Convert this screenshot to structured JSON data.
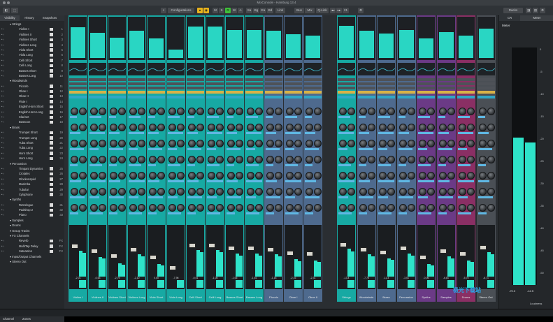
{
  "window": {
    "title": "MixConsole - Hamburg 13.4"
  },
  "toolbar": {
    "configurations_label": "Configurations",
    "buttons": [
      "M",
      "S",
      "R",
      "W",
      "A",
      "Sa",
      "Bg",
      "Ea",
      "Bd",
      "Link",
      "Bus",
      "Mix",
      "Q-Link"
    ],
    "page_num": "21",
    "racks_label": "Racks"
  },
  "left_panel": {
    "tabs": [
      "Visibility",
      "History",
      "Snapshots"
    ],
    "tracks": [
      {
        "name": "Strings",
        "num": ""
      },
      {
        "name": "Violins I",
        "num": "1"
      },
      {
        "name": "Violines II",
        "num": "2"
      },
      {
        "name": "Violines Short",
        "num": "3"
      },
      {
        "name": "Violines Long",
        "num": "4"
      },
      {
        "name": "Viola Short",
        "num": "5"
      },
      {
        "name": "Viola Long",
        "num": "6"
      },
      {
        "name": "Celli Short",
        "num": "7"
      },
      {
        "name": "Celli Long",
        "num": "8"
      },
      {
        "name": "Basses Short",
        "num": "9"
      },
      {
        "name": "Basses Long",
        "num": "10"
      },
      {
        "name": "Woodwinds",
        "num": ""
      },
      {
        "name": "Piccolo",
        "num": "11"
      },
      {
        "name": "Oboe I",
        "num": "12"
      },
      {
        "name": "Oboe II",
        "num": "13"
      },
      {
        "name": "Flute I",
        "num": "14"
      },
      {
        "name": "English Horn Short",
        "num": "15"
      },
      {
        "name": "English Horn Long",
        "num": "16"
      },
      {
        "name": "Clarinet",
        "num": "17"
      },
      {
        "name": "Bassoon",
        "num": "18"
      },
      {
        "name": "Brass",
        "num": ""
      },
      {
        "name": "Trumpet Short",
        "num": "19"
      },
      {
        "name": "Trumpet Long",
        "num": "20"
      },
      {
        "name": "Tuba Short",
        "num": "21"
      },
      {
        "name": "Tuba Long",
        "num": "22"
      },
      {
        "name": "Horn Short",
        "num": "23"
      },
      {
        "name": "Horn Long",
        "num": "24"
      },
      {
        "name": "Percussion",
        "num": ""
      },
      {
        "name": "Timpani Dynamics",
        "num": "25"
      },
      {
        "name": "Crotales",
        "num": "26"
      },
      {
        "name": "Glockenspiel",
        "num": "27"
      },
      {
        "name": "Marimba",
        "num": "28"
      },
      {
        "name": "Tubular",
        "num": "29"
      },
      {
        "name": "Xylophone",
        "num": "30"
      },
      {
        "name": "Synths",
        "num": ""
      },
      {
        "name": "Retrologue",
        "num": "31"
      },
      {
        "name": "Padshop 2",
        "num": "32"
      },
      {
        "name": "Piano",
        "num": "33"
      },
      {
        "name": "Samples",
        "num": ""
      },
      {
        "name": "Drums",
        "num": ""
      },
      {
        "name": "Group Tracks",
        "num": ""
      },
      {
        "name": "FX Channels",
        "num": ""
      },
      {
        "name": "Reverb",
        "num": "FX"
      },
      {
        "name": "MultiTap Delay",
        "num": "FX"
      },
      {
        "name": "Saturation",
        "num": "FX"
      },
      {
        "name": "Input/Output Channels",
        "num": ""
      },
      {
        "name": "Stereo Out",
        "num": ""
      }
    ],
    "bottom_tabs": [
      "Channel",
      "Zones"
    ]
  },
  "mixer": {
    "strips": [
      {
        "name": "Violins I",
        "val": "-2.01",
        "meter": 0.78,
        "color": "#17a9a3"
      },
      {
        "name": "Violines II",
        "val": "-0.63",
        "meter": 0.65,
        "color": "#17a9a3"
      },
      {
        "name": "Violines Short",
        "val": "-2.79",
        "meter": 0.52,
        "color": "#17a9a3"
      },
      {
        "name": "Violines Long",
        "val": "-2.10",
        "meter": 0.7,
        "color": "#17a9a3"
      },
      {
        "name": "Viola Short",
        "val": "0.00",
        "meter": 0.5,
        "color": "#17a9a3"
      },
      {
        "name": "Viola Long",
        "val": "-7.96",
        "meter": 0.22,
        "color": "#17a9a3"
      },
      {
        "name": "Celli Short",
        "val": "-0.01",
        "meter": 0.8,
        "color": "#17a9a3"
      },
      {
        "name": "Celli Long",
        "val": "-1.05",
        "meter": 0.8,
        "color": "#17a9a3"
      },
      {
        "name": "Basses Short",
        "val": "-1.06",
        "meter": 0.72,
        "color": "#17a9a3"
      },
      {
        "name": "Basses Long",
        "val": "-1.61",
        "meter": 0.72,
        "color": "#17a9a3"
      },
      {
        "name": "Piccolo",
        "val": "-1.18",
        "meter": 0.7,
        "color": "#4e6a8e"
      },
      {
        "name": "Oboe I",
        "val": "-2.16",
        "meter": 0.6,
        "color": "#4e6a8e"
      },
      {
        "name": "Oboe II",
        "val": "-2.31",
        "meter": 0.58,
        "color": "#4e6a8e"
      },
      {
        "name": "Strings",
        "val": "-13.4",
        "meter": 0.82,
        "color": "#17a9a3"
      },
      {
        "name": "Woodwinds",
        "val": "-7.75",
        "meter": 0.7,
        "color": "#4e6a8e"
      },
      {
        "name": "Brass",
        "val": "-11.4",
        "meter": 0.62,
        "color": "#4e6a8e"
      },
      {
        "name": "Percussion",
        "val": "-3.01",
        "meter": 0.72,
        "color": "#4e6a8e"
      },
      {
        "name": "Synths",
        "val": "-0.06",
        "meter": 0.5,
        "color": "#6b3a86"
      },
      {
        "name": "Samples",
        "val": "-6.81",
        "meter": 0.66,
        "color": "#6b3a86"
      },
      {
        "name": "Drums",
        "val": "-5.75",
        "meter": 0.58,
        "color": "#8a2f64"
      },
      {
        "name": "Stereo Out",
        "val": "-6.71",
        "meter": 0.75,
        "color": "#4a4f55"
      }
    ]
  },
  "right_panel": {
    "tabs": [
      "CR",
      "Meter"
    ],
    "section": "Meter",
    "readouts": [
      "-70.3",
      "-12.5"
    ],
    "scale_marks": [
      "0",
      "-5",
      "-10",
      "-15",
      "-20",
      "-25",
      "-30",
      "-35",
      "-40",
      "-45",
      "-50"
    ],
    "bottom_label": "Loudness"
  },
  "watermark": "极光下载站"
}
